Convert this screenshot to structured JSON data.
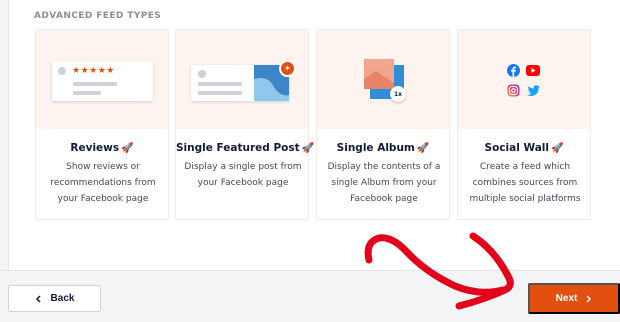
{
  "section": {
    "title": "ADVANCED FEED TYPES"
  },
  "cards": [
    {
      "title": "Reviews",
      "description": "Show reviews or recommendations from your Facebook page",
      "stars": "★★★★★"
    },
    {
      "title": "Single Featured Post",
      "description": "Display a single post from your Facebook page"
    },
    {
      "title": "Single Album",
      "description": "Display the contents of a single Album from your Facebook page",
      "badge": "1x"
    },
    {
      "title": "Social Wall",
      "description": "Create a feed which combines sources from multiple social platforms"
    }
  ],
  "footer": {
    "back_label": "Back",
    "next_label": "Next"
  },
  "colors": {
    "accent": "#e34f0e",
    "card_visual_bg": "#fdf3ef",
    "facebook": "#1877f2",
    "youtube": "#ff0000",
    "instagram": "#e1306c",
    "twitter": "#1da1f2"
  },
  "icons": {
    "card_title": "rocket-icon",
    "back": "chevron-left-icon",
    "next": "chevron-right-icon",
    "pin": "pin-icon"
  }
}
